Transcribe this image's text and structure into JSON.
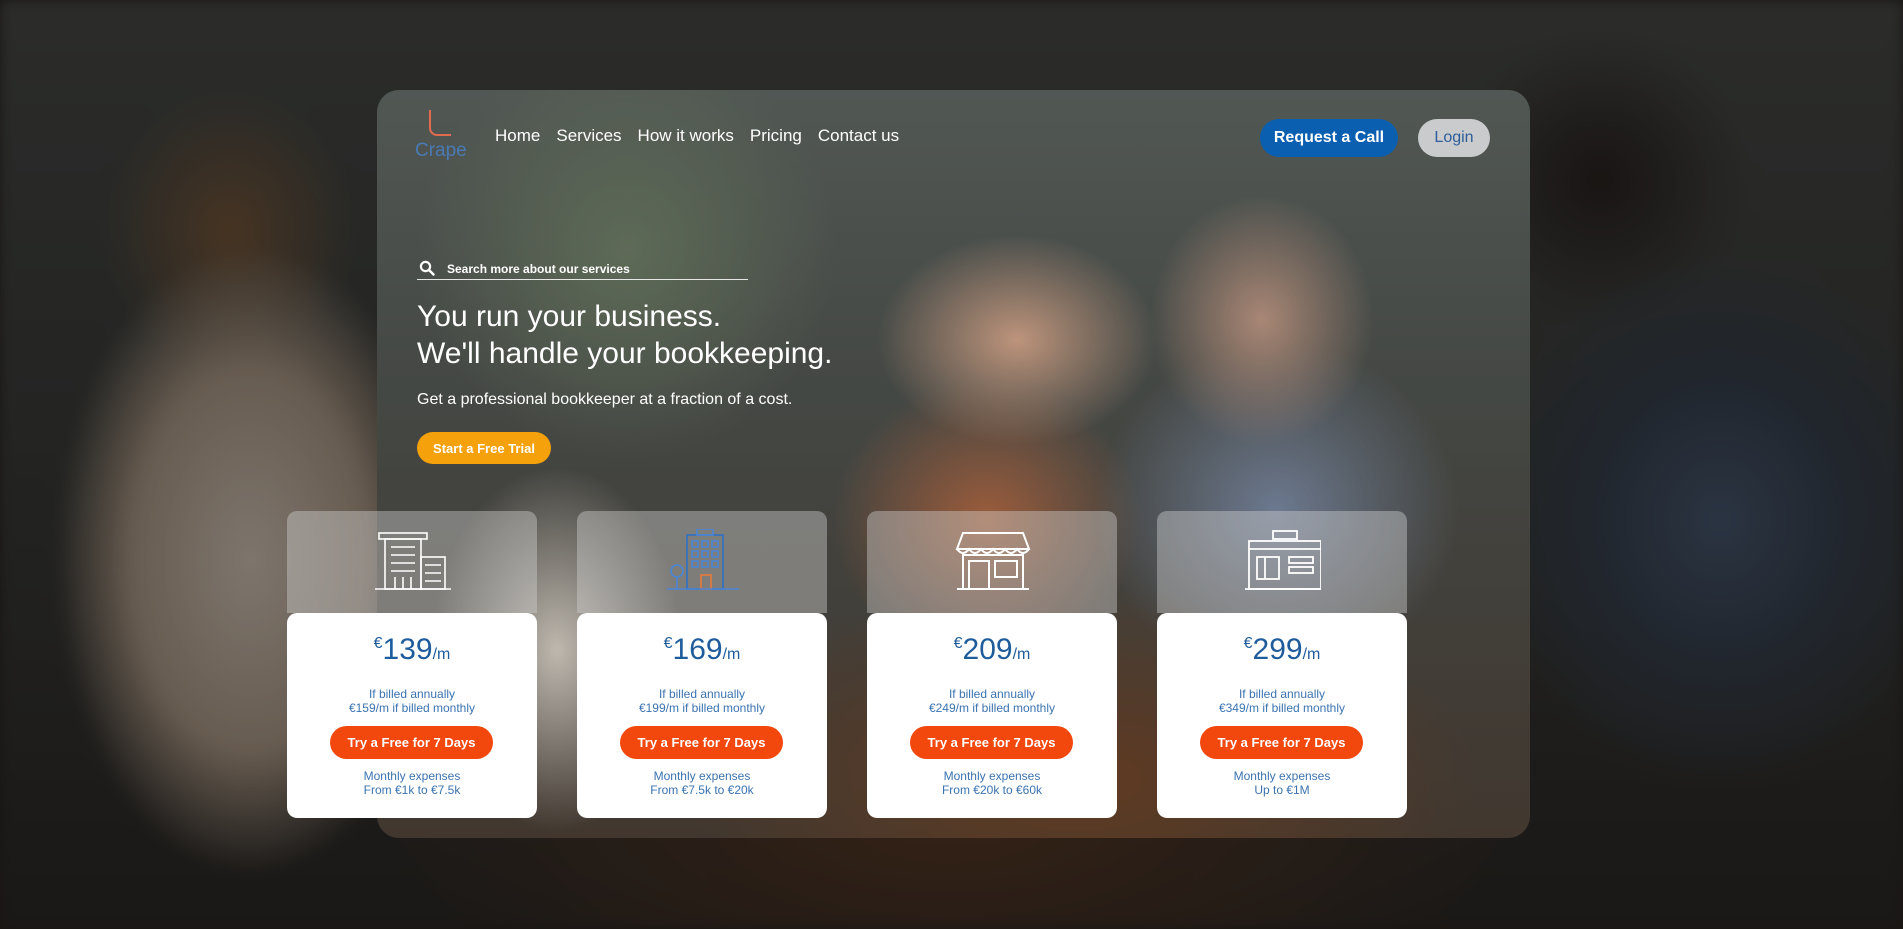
{
  "brand": {
    "logo_text": "Crape"
  },
  "nav": {
    "items": [
      "Home",
      "Services",
      "How it works",
      "Pricing",
      "Contact us"
    ],
    "request_call": "Request a Call",
    "login": "Login"
  },
  "search": {
    "placeholder": "Search more about our services"
  },
  "hero": {
    "headline_line1": "You run your business.",
    "headline_line2": "We'll handle your bookkeeping.",
    "subheadline": "Get a professional bookkeeper at a fraction of a cost.",
    "cta": "Start a Free Trial"
  },
  "colors": {
    "primary_blue": "#0b5fb0",
    "accent_orange": "#f5a10b",
    "cta_red_orange": "#f2470d"
  },
  "plans": [
    {
      "icon": "office-building-icon",
      "currency": "€",
      "amount": "139",
      "period": "/m",
      "billing_annual": "If billed annually",
      "billing_monthly": "€159/m if billed monthly",
      "button": "Try a Free for 7 Days",
      "expenses_label": "Monthly expenses",
      "expenses_range": "From €1k to €7.5k"
    },
    {
      "icon": "city-building-icon",
      "currency": "€",
      "amount": "169",
      "period": "/m",
      "billing_annual": "If billed annually",
      "billing_monthly": "€199/m if billed monthly",
      "button": "Try a Free for 7 Days",
      "expenses_label": "Monthly expenses",
      "expenses_range": "From €7.5k to €20k"
    },
    {
      "icon": "storefront-icon",
      "currency": "€",
      "amount": "209",
      "period": "/m",
      "billing_annual": "If billed annually",
      "billing_monthly": "€249/m if billed monthly",
      "button": "Try a Free for 7 Days",
      "expenses_label": "Monthly expenses",
      "expenses_range": "From €20k to €60k"
    },
    {
      "icon": "shop-counter-icon",
      "currency": "€",
      "amount": "299",
      "period": "/m",
      "billing_annual": "If billed annually",
      "billing_monthly": "€349/m if billed monthly",
      "button": "Try a Free for 7 Days",
      "expenses_label": "Monthly expenses",
      "expenses_range": "Up to €1M"
    }
  ]
}
